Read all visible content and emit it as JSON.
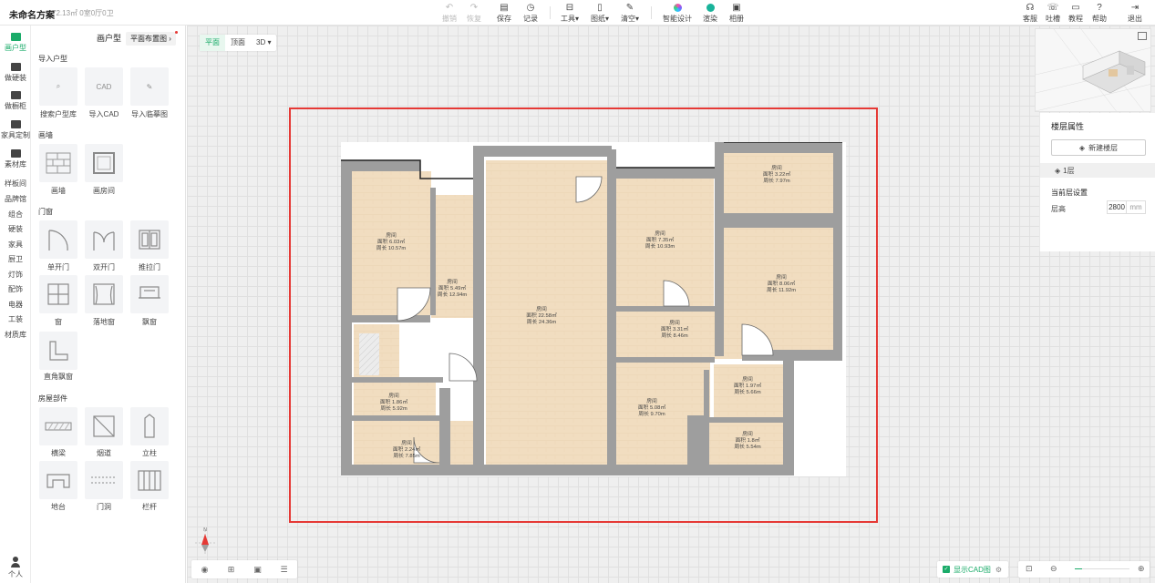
{
  "project": {
    "title": "未命名方案",
    "subtitle": "72.13㎡ 0室0厅0卫"
  },
  "toolbar": {
    "undo": "撤销",
    "redo": "恢复",
    "save": "保存",
    "history": "记录",
    "tools": "工具",
    "drawings": "图纸",
    "clear": "清空",
    "ai_design": "智能设计",
    "render": "渲染",
    "album": "相册",
    "support": "客服",
    "feedback": "吐槽",
    "tutorial": "教程",
    "help": "帮助",
    "exit": "退出"
  },
  "rail": {
    "items": [
      "画户型",
      "做硬装",
      "做橱柜",
      "家具定制",
      "素材库"
    ],
    "text_items": [
      "样板间",
      "品牌馆",
      "组合",
      "硬装",
      "家具",
      "厨卫",
      "灯饰",
      "配饰",
      "电器",
      "工装",
      "材质库"
    ],
    "user": "个人"
  },
  "panel": {
    "tab_active": "画户型",
    "tab_other": "平面布置图",
    "section_import": "导入户型",
    "import_items": [
      "搜索户型库",
      "导入CAD",
      "导入临摹图"
    ],
    "section_wall": "画墙",
    "wall_items": [
      "画墙",
      "画房间"
    ],
    "section_doors": "门窗",
    "door_items": [
      "单开门",
      "双开门",
      "推拉门",
      "窗",
      "落地窗",
      "飘窗",
      "直角飘窗"
    ],
    "section_parts": "房屋部件",
    "part_items": [
      "横梁",
      "烟道",
      "立柱",
      "地台",
      "门洞",
      "栏杆"
    ]
  },
  "canvas": {
    "view_tabs": [
      "平面",
      "顶面",
      "3D"
    ],
    "active_view": "平面",
    "cad_toggle": "显示CAD图",
    "compass_north": "N"
  },
  "floor_panel": {
    "title": "楼层属性",
    "new_floor": "新建楼层",
    "floor": "1层",
    "current_settings": "当前层设置",
    "height_label": "层高",
    "height_value": "2800",
    "height_unit": "mm"
  },
  "rooms": [
    {
      "name": "房间",
      "area": "面积 6.03㎡",
      "perimeter": "周长 10.57m"
    },
    {
      "name": "房间",
      "area": "面积 5.49㎡",
      "perimeter": "周长 12.94m"
    },
    {
      "name": "房间",
      "area": "面积 22.58㎡",
      "perimeter": "周长 24.36m"
    },
    {
      "name": "房间",
      "area": "面积 7.35㎡",
      "perimeter": "周长 10.93m"
    },
    {
      "name": "房间",
      "area": "面积 3.22㎡",
      "perimeter": "周长 7.97m"
    },
    {
      "name": "房间",
      "area": "面积 8.06㎡",
      "perimeter": "周长 11.92m"
    },
    {
      "name": "房间",
      "area": "面积 3.31㎡",
      "perimeter": "周长 8.46m"
    },
    {
      "name": "房间",
      "area": "面积 5.08㎡",
      "perimeter": "周长 9.70m"
    },
    {
      "name": "房间",
      "area": "面积 1.97㎡",
      "perimeter": "周长 5.66m"
    },
    {
      "name": "房间",
      "area": "面积 1.8㎡",
      "perimeter": "周长 5.54m"
    },
    {
      "name": "房间",
      "area": "面积 1.86㎡",
      "perimeter": "周长 5.92m"
    },
    {
      "name": "房间",
      "area": "面积 2.24㎡",
      "perimeter": "周长 7.85m"
    }
  ],
  "colors": {
    "accent": "#1aab69",
    "selection": "#e53935",
    "floor": "#f0dcc0",
    "wall": "#9e9e9e"
  }
}
